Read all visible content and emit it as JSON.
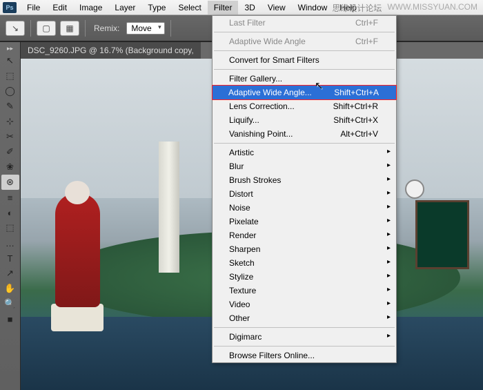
{
  "app": {
    "logo": "Ps"
  },
  "menubar": [
    "File",
    "Edit",
    "Image",
    "Layer",
    "Type",
    "Select",
    "Filter",
    "3D",
    "View",
    "Window",
    "Help"
  ],
  "active_menu_index": 6,
  "watermark": {
    "left": "思缘设计论坛",
    "right": "WWW.MISSYUAN.COM"
  },
  "options": {
    "remix_label": "Remix:",
    "remix_value": "Move"
  },
  "doc_tab": "DSC_9260.JPG @ 16.7% (Background copy, ",
  "tools": [
    "↖",
    "⬚",
    "◯",
    "✎",
    "⊹",
    "✂",
    "✐",
    "❀",
    "⊛",
    "≡",
    "◐",
    "⬚",
    "…",
    "T",
    "↗",
    "✋",
    "🔍",
    "■"
  ],
  "selected_tool_index": 8,
  "dropdown": {
    "sections": [
      [
        {
          "label": "Last Filter",
          "shortcut": "Ctrl+F",
          "disabled": true
        }
      ],
      [
        {
          "label": "Adaptive Wide Angle",
          "shortcut": "Ctrl+F",
          "disabled": true
        }
      ],
      [
        {
          "label": "Convert for Smart Filters"
        }
      ],
      [
        {
          "label": "Filter Gallery..."
        },
        {
          "label": "Adaptive Wide Angle...",
          "shortcut": "Shift+Ctrl+A",
          "highlight": true
        },
        {
          "label": "Lens Correction...",
          "shortcut": "Shift+Ctrl+R"
        },
        {
          "label": "Liquify...",
          "shortcut": "Shift+Ctrl+X"
        },
        {
          "label": "Vanishing Point...",
          "shortcut": "Alt+Ctrl+V"
        }
      ],
      [
        {
          "label": "Artistic",
          "submenu": true
        },
        {
          "label": "Blur",
          "submenu": true
        },
        {
          "label": "Brush Strokes",
          "submenu": true
        },
        {
          "label": "Distort",
          "submenu": true
        },
        {
          "label": "Noise",
          "submenu": true
        },
        {
          "label": "Pixelate",
          "submenu": true
        },
        {
          "label": "Render",
          "submenu": true
        },
        {
          "label": "Sharpen",
          "submenu": true
        },
        {
          "label": "Sketch",
          "submenu": true
        },
        {
          "label": "Stylize",
          "submenu": true
        },
        {
          "label": "Texture",
          "submenu": true
        },
        {
          "label": "Video",
          "submenu": true
        },
        {
          "label": "Other",
          "submenu": true
        }
      ],
      [
        {
          "label": "Digimarc",
          "submenu": true
        }
      ],
      [
        {
          "label": "Browse Filters Online..."
        }
      ]
    ]
  }
}
